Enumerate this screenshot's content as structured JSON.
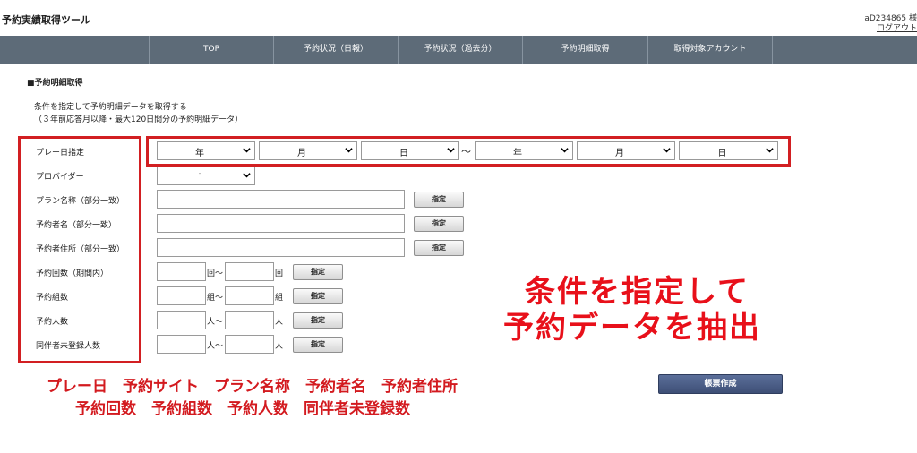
{
  "header": {
    "app_title": "予約実績取得ツール",
    "user_id": "aD234865 様",
    "logout": "ログアウト"
  },
  "nav": {
    "items": [
      "TOP",
      "予約状況（日報）",
      "予約状況（過去分）",
      "予約明細取得",
      "取得対象アカウント"
    ]
  },
  "section": {
    "title": "■予約明細取得",
    "desc_line1": "条件を指定して予約明細データを取得する",
    "desc_line2": "（３年前応答月以降・最大120日間分の予約明細データ）"
  },
  "form": {
    "play_date_label": "プレー日指定",
    "date_selects": {
      "year": "年",
      "month": "月",
      "day": "日",
      "tilde": "～"
    },
    "provider_label": "プロバイダー",
    "provider_value": "-",
    "plan_label": "プラン名称（部分一致）",
    "booker_label": "予約者名（部分一致）",
    "address_label": "予約者住所（部分一致）",
    "count_label": "予約回数（期間内）",
    "groups_label": "予約組数",
    "people_label": "予約人数",
    "unregistered_label": "同伴者未登録人数",
    "unit_count": "回",
    "unit_groups": "組",
    "unit_people": "人",
    "range_tilde": "～",
    "specify_button": "指定"
  },
  "annotation": {
    "big_line1": "条件を指定して",
    "big_line2": "予約データを抽出",
    "small_line1": "プレー日　予約サイト　プラン名称　予約者名　予約者住所",
    "small_line2": "予約回数　予約組数　予約人数　同伴者未登録数"
  },
  "report_button": "帳票作成",
  "colors": {
    "navbar": "#5d6b78",
    "annotation_red": "#e8101a",
    "report_button": "#45557d"
  }
}
